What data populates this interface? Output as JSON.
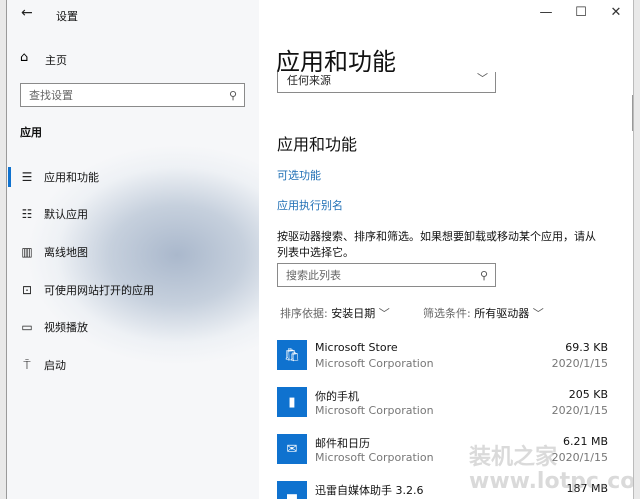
{
  "window": {
    "title": "设置"
  },
  "sidebar": {
    "home": "主页",
    "search_placeholder": "查找设置",
    "section": "应用",
    "items": [
      {
        "label": "应用和功能",
        "icon": "list-icon"
      },
      {
        "label": "默认应用",
        "icon": "default-apps-icon"
      },
      {
        "label": "离线地图",
        "icon": "map-icon"
      },
      {
        "label": "可使用网站打开的应用",
        "icon": "web-app-icon"
      },
      {
        "label": "视频播放",
        "icon": "video-icon"
      },
      {
        "label": "启动",
        "icon": "startup-icon"
      }
    ]
  },
  "main": {
    "page_title": "应用和功能",
    "source_dropdown": "任何来源",
    "section_heading": "应用和功能",
    "link_optional": "可选功能",
    "link_alias": "应用执行别名",
    "description": "按驱动器搜索、排序和筛选。如果想要卸载或移动某个应用，请从列表中选择它。",
    "list_search_placeholder": "搜索此列表",
    "sort_label": "排序依据:",
    "sort_value": "安装日期",
    "filter_label": "筛选条件:",
    "filter_value": "所有驱动器",
    "apps": [
      {
        "name": "Microsoft Store",
        "publisher": "Microsoft Corporation",
        "size": "69.3 KB",
        "date": "2020/1/15"
      },
      {
        "name": "你的手机",
        "publisher": "Microsoft Corporation",
        "size": "205 KB",
        "date": "2020/1/15"
      },
      {
        "name": "邮件和日历",
        "publisher": "Microsoft Corporation",
        "size": "6.21 MB",
        "date": "2020/1/15"
      },
      {
        "name": "迅雷自媒体助手 3.2.6",
        "publisher": "",
        "size": "187 MB",
        "date": ""
      }
    ]
  },
  "watermark": "装机之家 www.lotpc.com",
  "colors": {
    "accent": "#0f72cf",
    "link": "#1f6fb5"
  }
}
